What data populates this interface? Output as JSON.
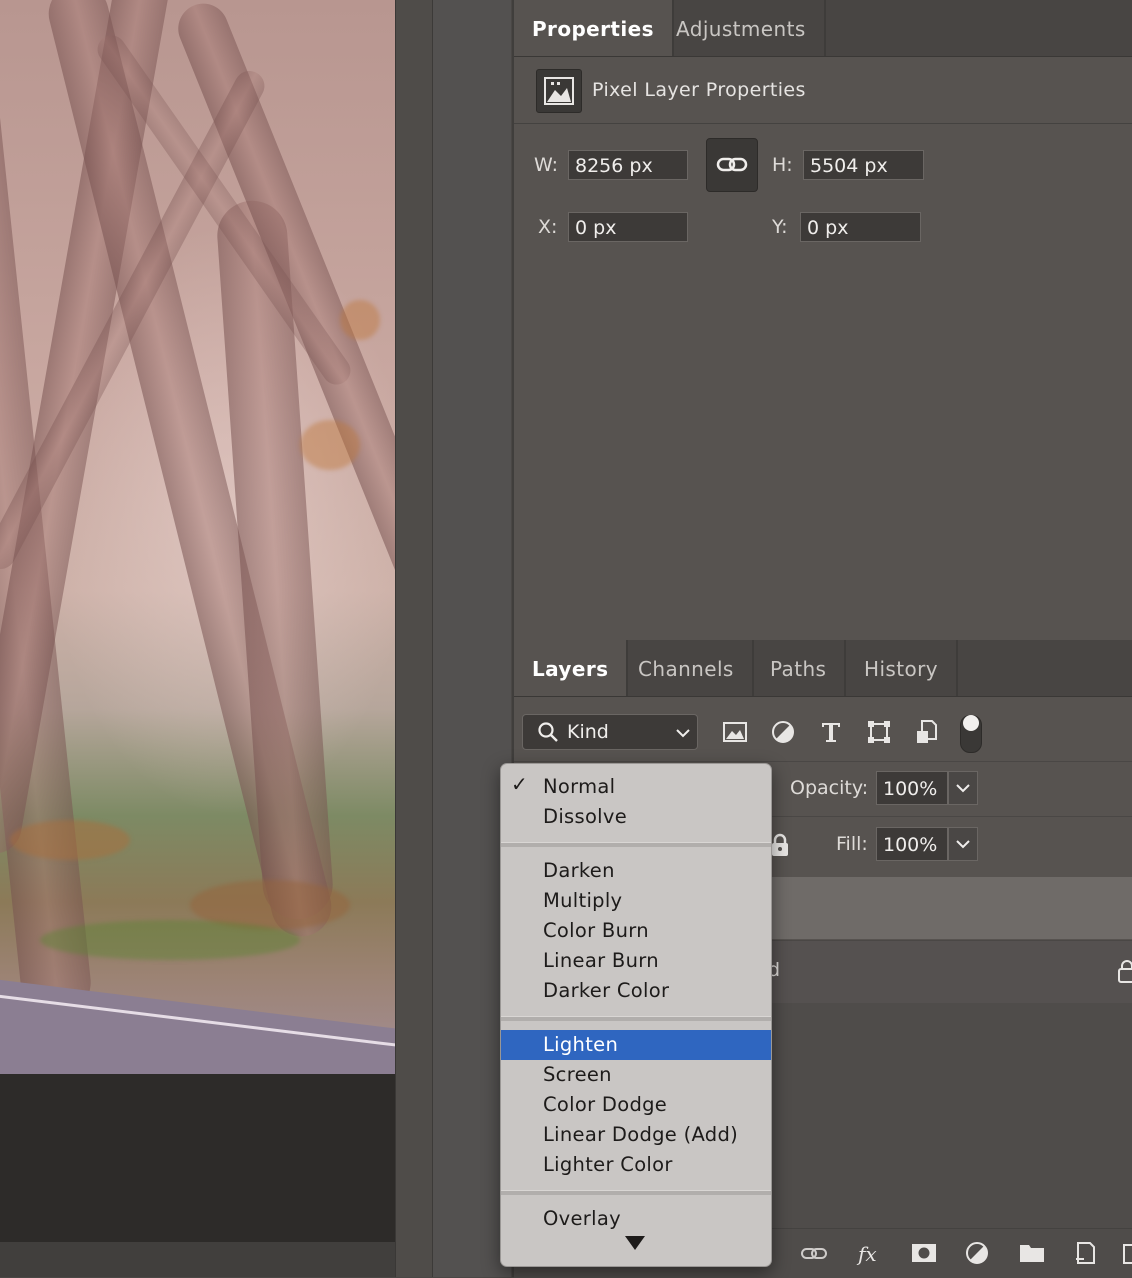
{
  "properties_panel": {
    "tabs": [
      {
        "label": "Properties",
        "active": true
      },
      {
        "label": "Adjustments",
        "active": false
      }
    ],
    "header_title": "Pixel Layer Properties",
    "w_label": "W:",
    "w_value": "8256 px",
    "h_label": "H:",
    "h_value": "5504 px",
    "x_label": "X:",
    "x_value": "0 px",
    "y_label": "Y:",
    "y_value": "0 px"
  },
  "layers_panel": {
    "tabs": [
      {
        "label": "Layers",
        "active": true
      },
      {
        "label": "Channels",
        "active": false
      },
      {
        "label": "Paths",
        "active": false
      },
      {
        "label": "History",
        "active": false
      }
    ],
    "filter_kind": "Kind",
    "opacity_label": "Opacity:",
    "opacity_value": "100%",
    "fill_label": "Fill:",
    "fill_value": "100%",
    "background_layer_name_partial": "d"
  },
  "blend_mode_menu": {
    "checked": "Normal",
    "highlighted": "Lighten",
    "groups": [
      [
        "Normal",
        "Dissolve"
      ],
      [
        "Darken",
        "Multiply",
        "Color Burn",
        "Linear Burn",
        "Darker Color"
      ],
      [
        "Lighten",
        "Screen",
        "Color Dodge",
        "Linear Dodge (Add)",
        "Lighter Color"
      ],
      [
        "Overlay"
      ]
    ],
    "more_indicator": "down-triangle"
  },
  "colors": {
    "panel_bg": "#575350",
    "menu_bg": "#c9c6c4",
    "menu_highlight": "#2f66c0"
  }
}
